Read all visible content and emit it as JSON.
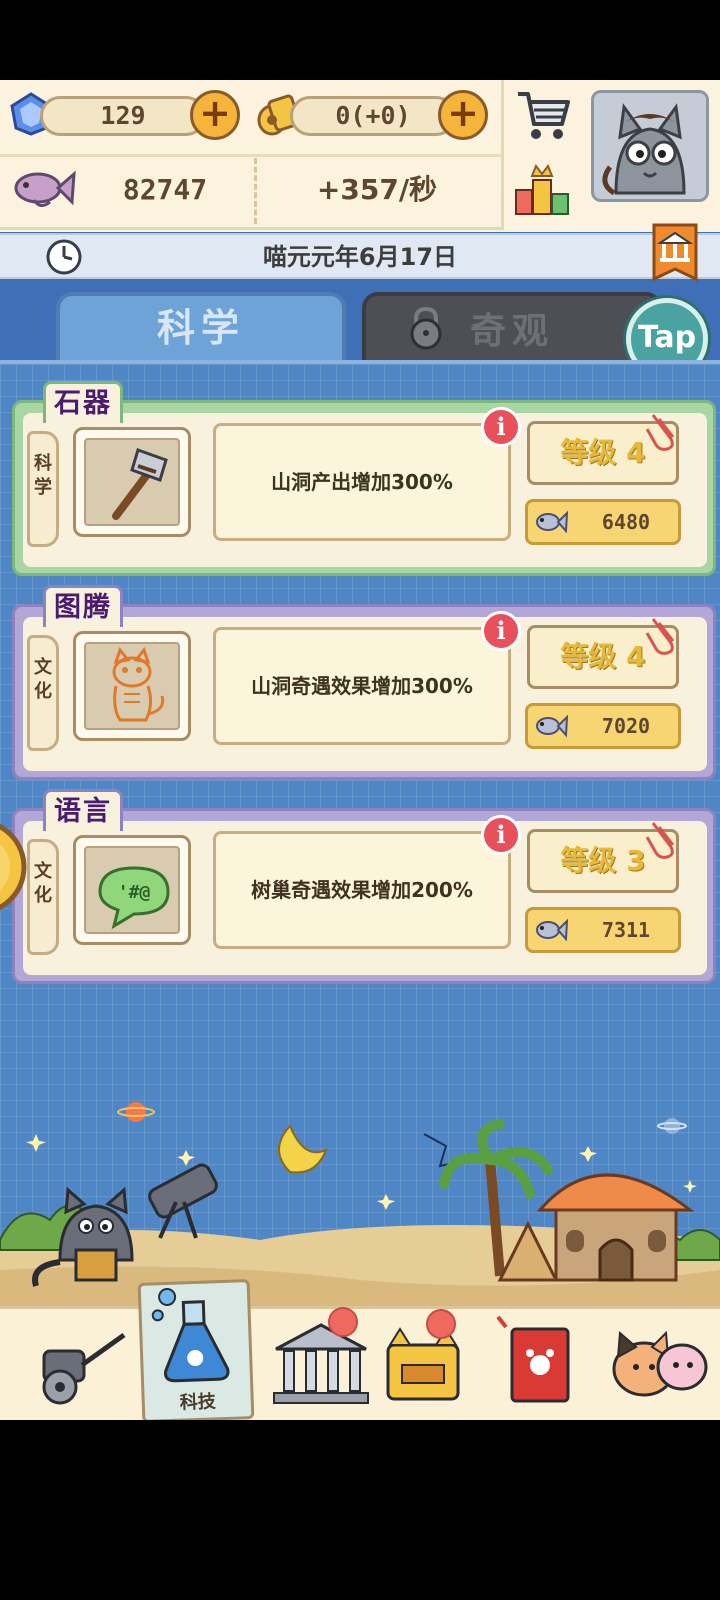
{
  "resources": {
    "gems": "129",
    "coins": "0(+0)",
    "fish_total": "82747",
    "fish_rate": "+357/秒"
  },
  "date": "喵元元年6月17日",
  "tabs": {
    "science": "科学",
    "wonder": "奇观"
  },
  "tap_label": "Tap",
  "techs": [
    {
      "title": "石器",
      "category": "科学",
      "description": "山洞产出增加300%",
      "level": "等级 4",
      "cost": "6480",
      "icon": "stone-hammer-icon"
    },
    {
      "title": "图腾",
      "category": "文化",
      "description": "山洞奇遇效果增加300%",
      "level": "等级 4",
      "cost": "7020",
      "icon": "cat-totem-icon"
    },
    {
      "title": "语言",
      "category": "文化",
      "description": "树巢奇遇效果增加200%",
      "level": "等级 3",
      "cost": "7311",
      "icon": "speech-bubble-icon"
    }
  ],
  "info_glyph": "i",
  "bottom_nav": {
    "active_label": "科技",
    "items": [
      "chariot-icon",
      "flask-icon",
      "museum-icon",
      "treasure-chest-icon",
      "cat-book-icon",
      "cat-friends-icon"
    ]
  },
  "colors": {
    "board_blue": "#4f86c6",
    "card_green": "#a8d7a4",
    "card_purple": "#b2a7d6",
    "level_gold": "#e8b838",
    "info_red": "#e8505b"
  }
}
